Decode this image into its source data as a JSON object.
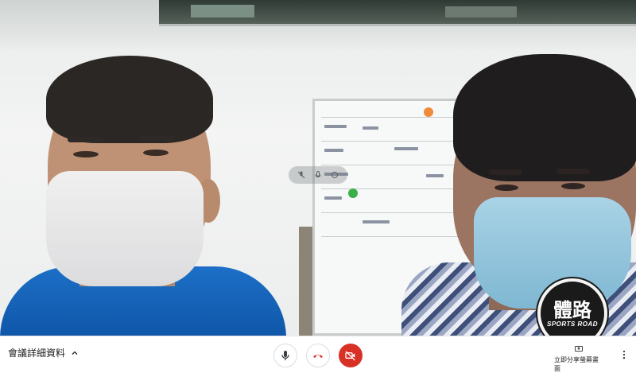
{
  "meeting": {
    "details_label": "會議詳細資料",
    "present_label": "立即分享螢幕畫面"
  },
  "watermark": {
    "logo_main": "體路",
    "logo_sub": "SPORTS ROAD"
  },
  "controls": {
    "mic": "microphone-icon",
    "hangup": "hangup-icon",
    "camera": "camera-off-icon",
    "more": "more-vert-icon"
  },
  "colors": {
    "camera_off_bg": "#d93025",
    "hangup_icon": "#d93025"
  }
}
